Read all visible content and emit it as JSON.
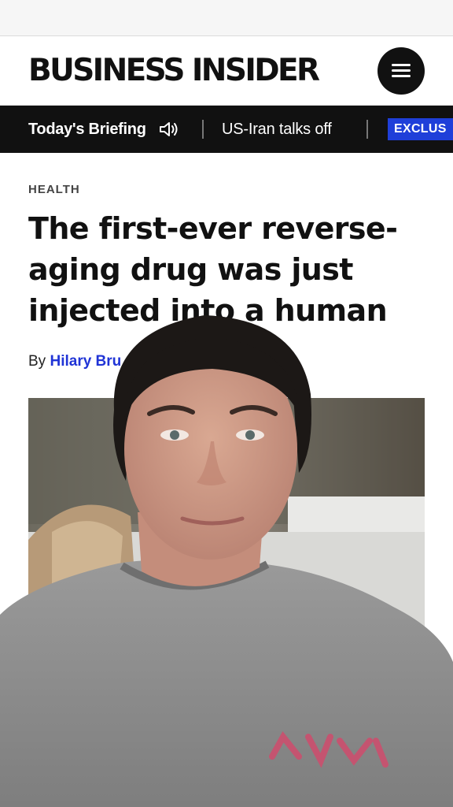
{
  "header": {
    "logo_text": "BUSINESS INSIDER",
    "menu_icon": "hamburger-menu-icon"
  },
  "ticker": {
    "briefing_label": "Today's Briefing",
    "speaker_icon": "speaker-icon",
    "headline": "US-Iran talks off",
    "badge_label": "EXCLUS"
  },
  "article": {
    "section": "HEALTH",
    "title": "The first-ever reverse-aging drug was just injected into a human",
    "byline_prefix": "By",
    "author": "Hilary Bru"
  },
  "colors": {
    "ticker_bg": "#111111",
    "author_link": "#2034d6",
    "badge_bg": "#1f3fd9"
  }
}
